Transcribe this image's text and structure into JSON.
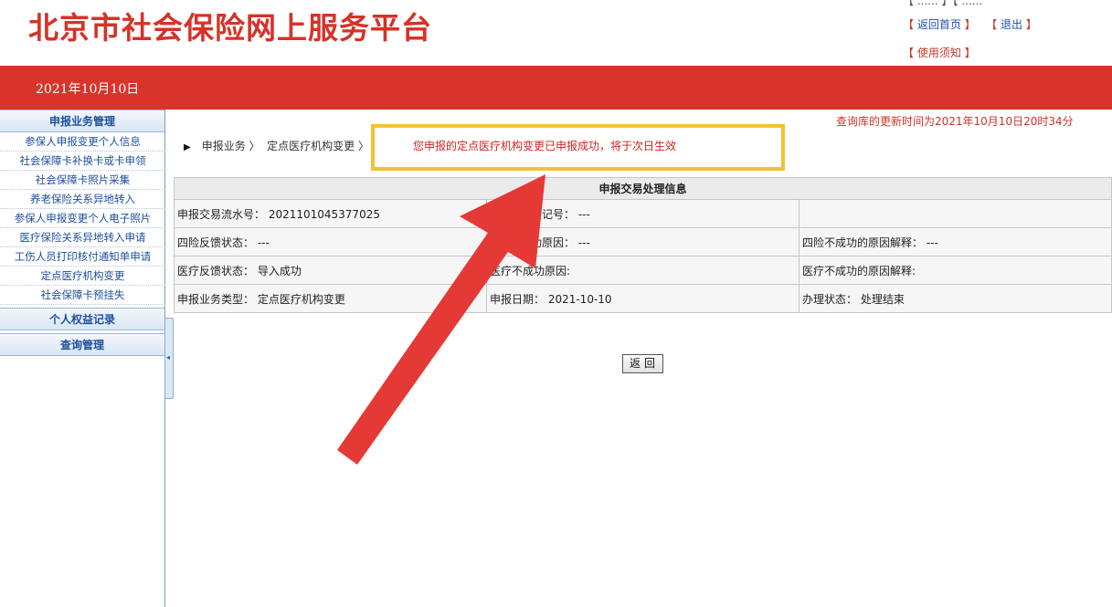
{
  "header": {
    "site_title": "北京市社会保险网上服务平台",
    "top_cut": "【 ...... 】【 ......",
    "links": {
      "home": "返回首页",
      "logout": "退出",
      "notice": "使用须知",
      "bracket_open": "【",
      "bracket_close": "】"
    },
    "date": "2021年10月10日"
  },
  "sidebar": {
    "section1": "申报业务管理",
    "items": [
      "参保人申报变更个人信息",
      "社会保障卡补换卡或卡申领",
      "社会保障卡照片采集",
      "养老保险关系异地转入",
      "参保人申报变更个人电子照片",
      "医疗保险关系异地转入申请",
      "工伤人员打印核付通知单申请",
      "定点医疗机构变更",
      "社会保障卡预挂失"
    ],
    "section2": "个人权益记录",
    "section3": "查询管理",
    "collapse_icon": "◂"
  },
  "main": {
    "update_time": "查询库的更新时间为2021年10月10日20时34分",
    "breadcrumb": {
      "arrow": "▶",
      "level1": "申报业务 〉",
      "level2": "定点医疗机构变更 〉"
    },
    "success_message": "您申报的定点医疗机构变更已申报成功，将于次日生效",
    "table": {
      "title": "申报交易处理信息",
      "rows": [
        [
          "申报交易流水号：  2021101045377025",
          "登记号： ---",
          ""
        ],
        [
          "四险反馈状态：  ---",
          "功原因：  ---",
          "四险不成功的原因解释：  ---"
        ],
        [
          "医疗反馈状态：  导入成功",
          "医疗不成功原因:",
          "医疗不成功的原因解释:"
        ],
        [
          "申报业务类型：  定点医疗机构变更",
          "申报日期：  2021-10-10",
          "办理状态：  处理结束"
        ]
      ]
    },
    "back_button": "返回"
  },
  "colors": {
    "brand_red": "#d8342c",
    "highlight_box": "#f2c230",
    "link_blue": "#1d4f9c",
    "annotation_arrow": "#e53935"
  }
}
